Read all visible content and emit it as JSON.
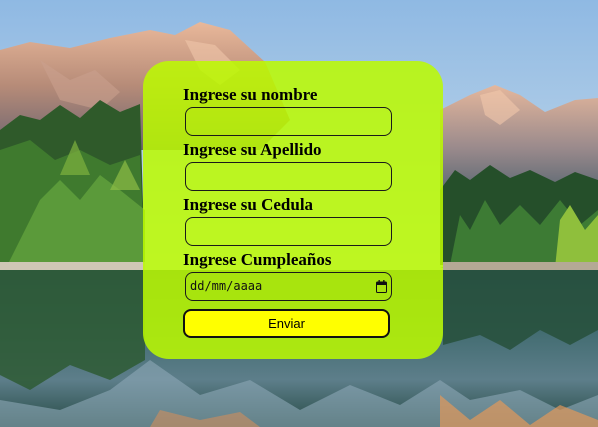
{
  "form": {
    "nombre_label": "Ingrese su nombre",
    "nombre_value": "",
    "apellido_label": "Ingrese su Apellido",
    "apellido_value": "",
    "cedula_label": "Ingrese su Cedula",
    "cedula_value": "",
    "cumpleanos_label": "Ingrese Cumpleaños",
    "cumpleanos_placeholder": "dd/mm/aaaa",
    "submit_label": "Enviar"
  },
  "colors": {
    "card_background": "#bcfa00",
    "button_background": "#ffff00",
    "border": "#1a1a1a"
  },
  "icons": {
    "date_picker": "calendar-icon"
  }
}
